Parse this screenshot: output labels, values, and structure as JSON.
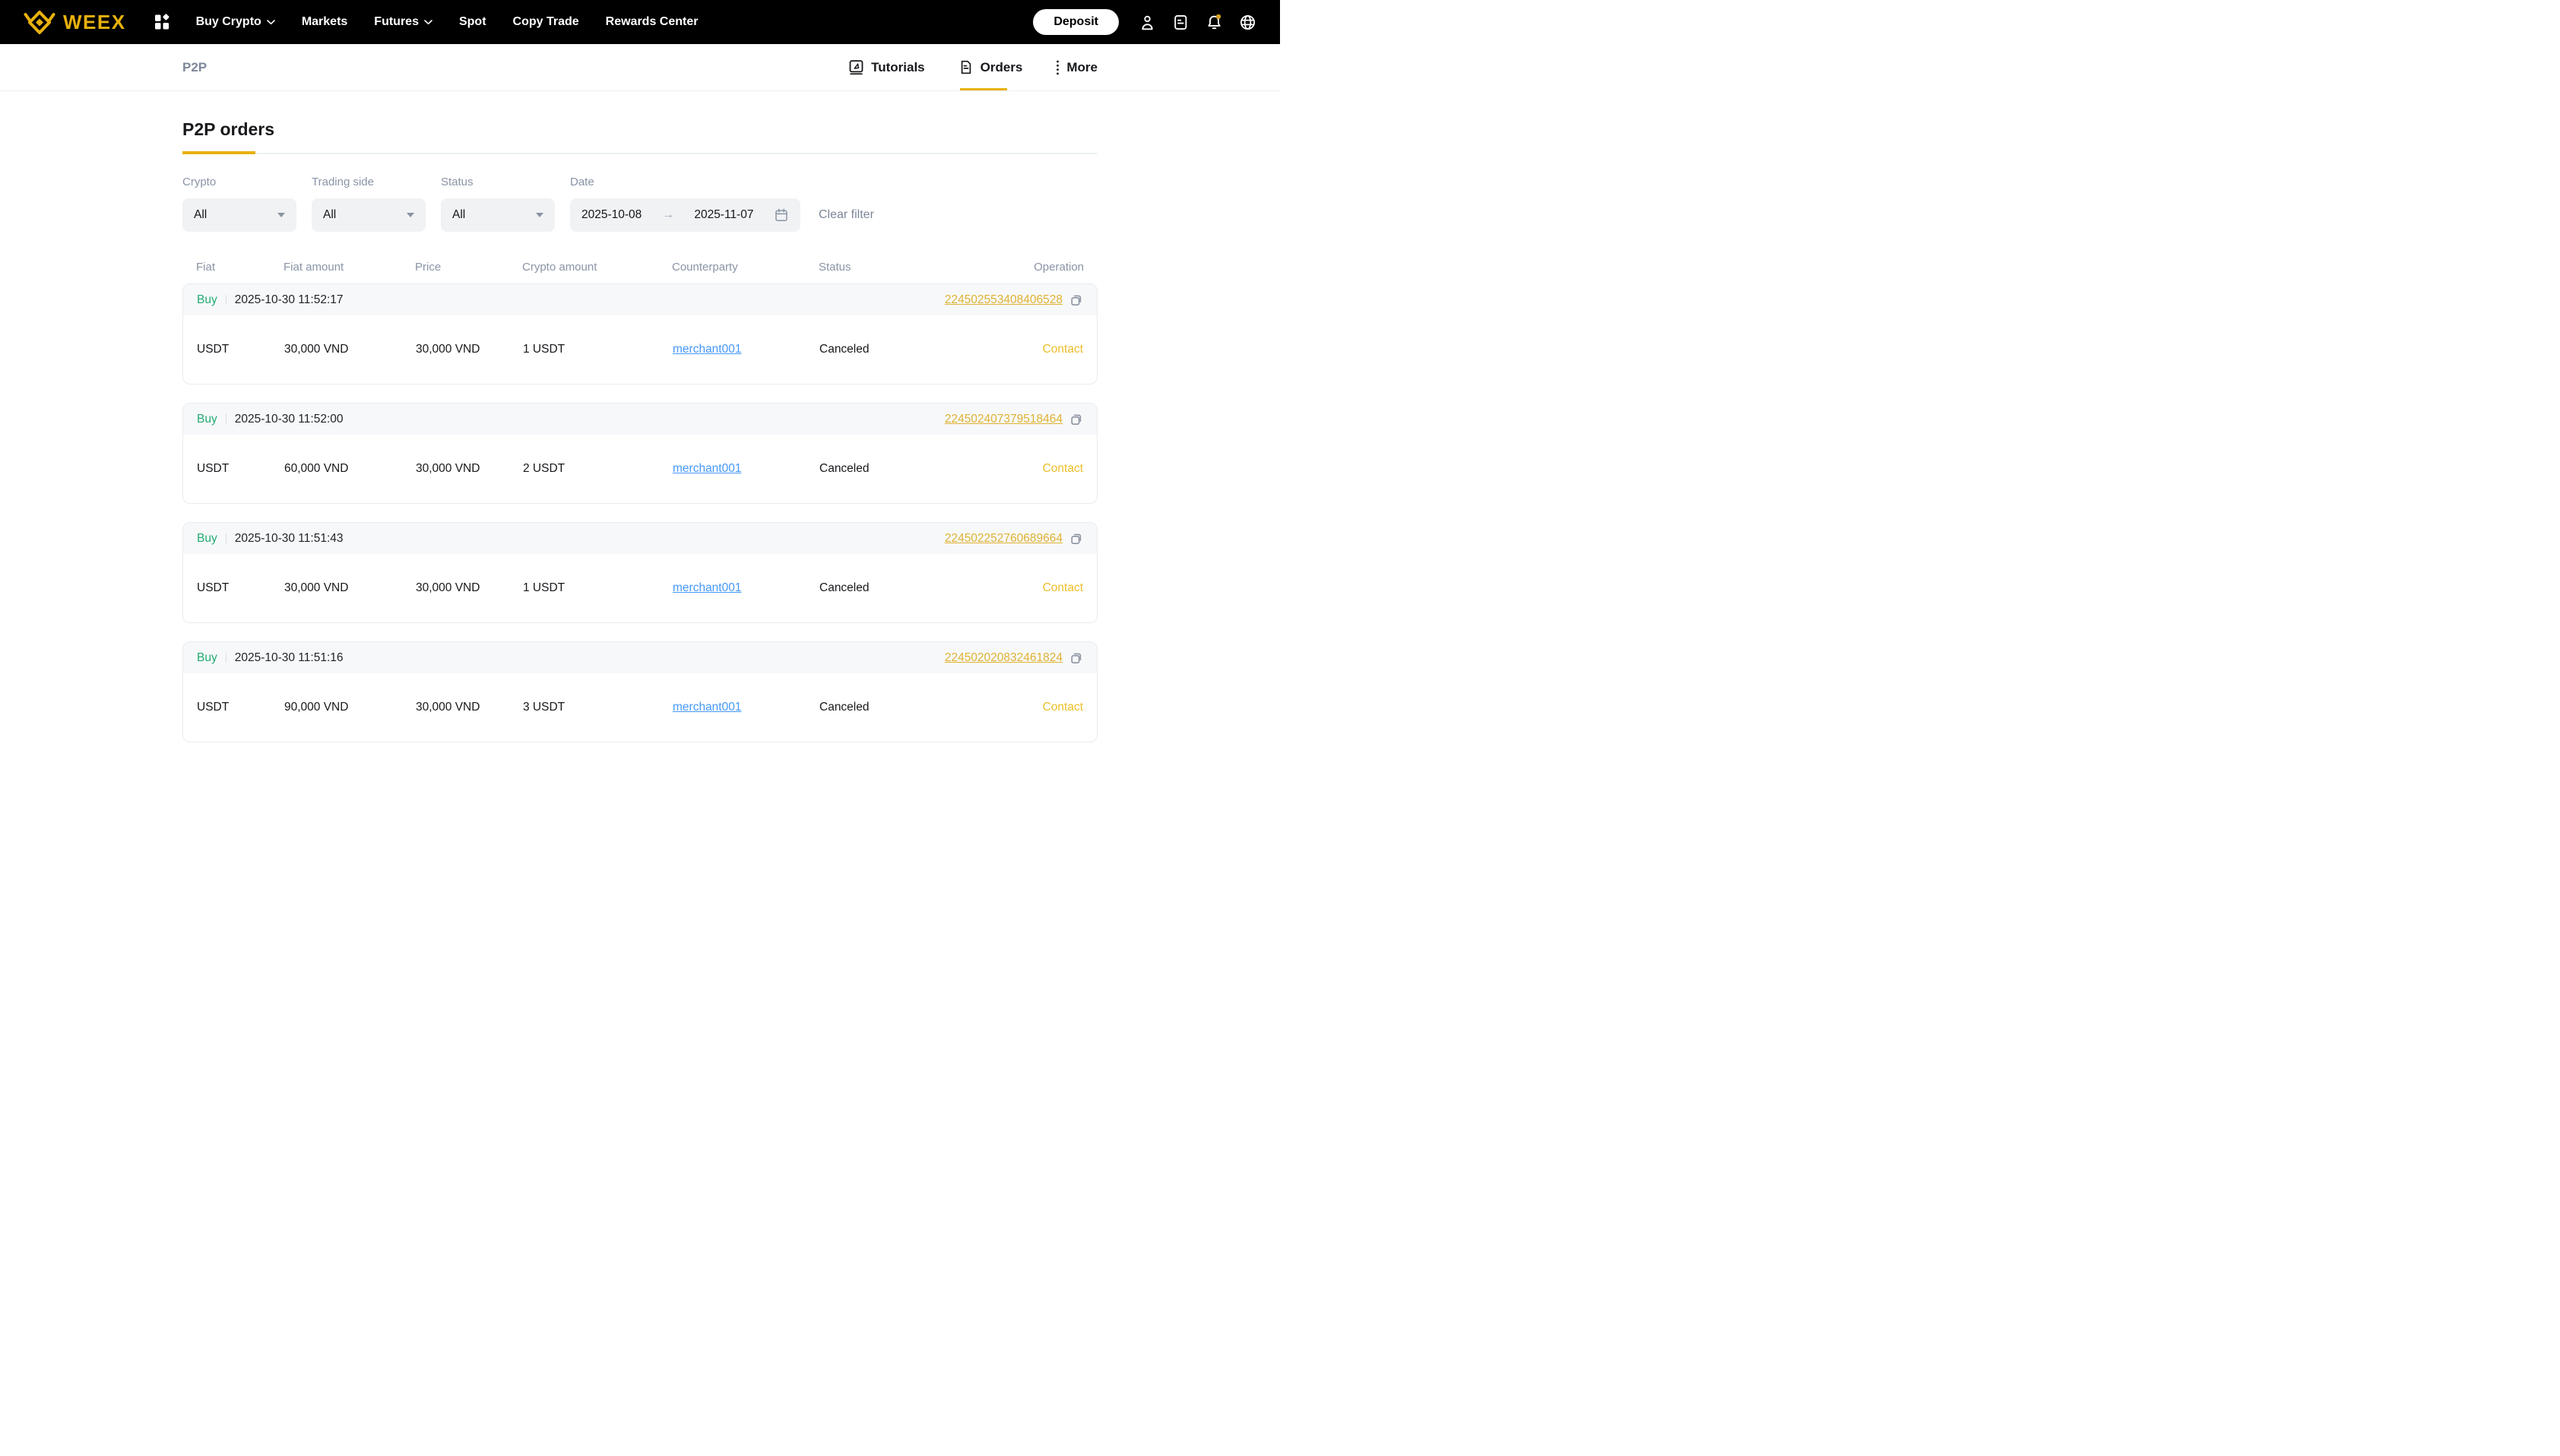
{
  "colors": {
    "brand_gold": "#e8b10e",
    "gold_link": "#dfb233",
    "gold_contact": "#ecbe27",
    "buy_green": "#23ab70",
    "link_blue": "#4598f7",
    "badge_gold": "#d2a321"
  },
  "brand": {
    "name": "WEEX"
  },
  "nav": {
    "items": [
      {
        "label": "Buy Crypto",
        "chevron": true
      },
      {
        "label": "Markets",
        "chevron": false
      },
      {
        "label": "Futures",
        "chevron": true
      },
      {
        "label": "Spot",
        "chevron": false
      },
      {
        "label": "Copy Trade",
        "chevron": false
      },
      {
        "label": "Rewards Center",
        "chevron": false
      }
    ]
  },
  "header": {
    "deposit_label": "Deposit"
  },
  "subheader": {
    "title": "P2P",
    "tabs": {
      "tutorials": "Tutorials",
      "orders": "Orders",
      "more": "More"
    }
  },
  "page": {
    "title": "P2P orders"
  },
  "filters": {
    "crypto_label": "Crypto",
    "crypto_value": "All",
    "trading_side_label": "Trading side",
    "trading_side_value": "All",
    "status_label": "Status",
    "status_value": "All",
    "date_label": "Date",
    "date_from": "2025-10-08",
    "date_to": "2025-11-07",
    "clear_label": "Clear filter"
  },
  "table": {
    "headers": [
      "Fiat",
      "Fiat amount",
      "Price",
      "Crypto amount",
      "Counterparty",
      "Status",
      "Operation"
    ],
    "orders": [
      {
        "side": "Buy",
        "time": "2025-10-30 11:52:17",
        "id": "224502553408406528",
        "fiat": "USDT",
        "fiat_amount": "30,000 VND",
        "price": "30,000 VND",
        "crypto_amount": "1 USDT",
        "counterparty": "merchant001",
        "status": "Canceled",
        "operation": "Contact"
      },
      {
        "side": "Buy",
        "time": "2025-10-30 11:52:00",
        "id": "224502407379518464",
        "fiat": "USDT",
        "fiat_amount": "60,000 VND",
        "price": "30,000 VND",
        "crypto_amount": "2 USDT",
        "counterparty": "merchant001",
        "status": "Canceled",
        "operation": "Contact"
      },
      {
        "side": "Buy",
        "time": "2025-10-30 11:51:43",
        "id": "224502252760689664",
        "fiat": "USDT",
        "fiat_amount": "30,000 VND",
        "price": "30,000 VND",
        "crypto_amount": "1 USDT",
        "counterparty": "merchant001",
        "status": "Canceled",
        "operation": "Contact"
      },
      {
        "side": "Buy",
        "time": "2025-10-30 11:51:16",
        "id": "224502020832461824",
        "fiat": "USDT",
        "fiat_amount": "90,000 VND",
        "price": "30,000 VND",
        "crypto_amount": "3 USDT",
        "counterparty": "merchant001",
        "status": "Canceled",
        "operation": "Contact"
      }
    ]
  }
}
